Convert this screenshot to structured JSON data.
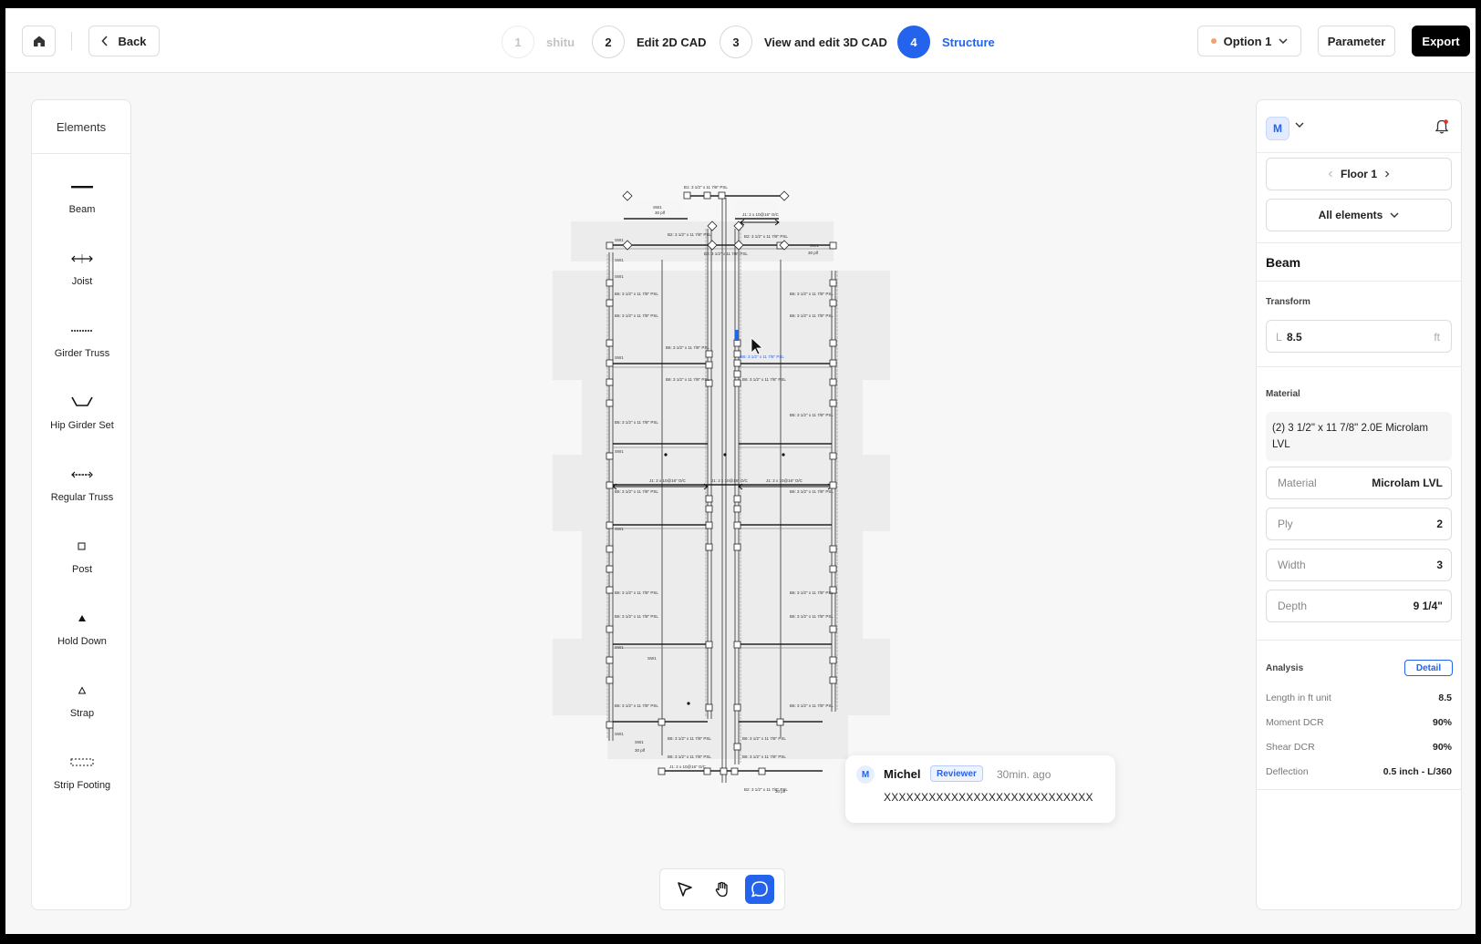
{
  "topbar": {
    "back_label": "Back",
    "steps": [
      {
        "num": "1",
        "label": "shitu"
      },
      {
        "num": "2",
        "label": "Edit 2D CAD"
      },
      {
        "num": "3",
        "label": "View and edit 3D CAD"
      },
      {
        "num": "4",
        "label": "Structure"
      }
    ],
    "option_label": "Option 1",
    "parameter_label": "Parameter",
    "export_label": "Export",
    "accent_color": "#2463eb"
  },
  "elements_panel": {
    "title": "Elements",
    "items": [
      {
        "label": "Beam",
        "icon": "beam-icon"
      },
      {
        "label": "Joist",
        "icon": "joist-icon"
      },
      {
        "label": "Girder Truss",
        "icon": "girder-truss-icon"
      },
      {
        "label": "Hip Girder Set",
        "icon": "hip-girder-set-icon"
      },
      {
        "label": "Regular Truss",
        "icon": "regular-truss-icon"
      },
      {
        "label": "Post",
        "icon": "post-icon"
      },
      {
        "label": "Hold Down",
        "icon": "hold-down-icon"
      },
      {
        "label": "Strap",
        "icon": "strap-icon"
      },
      {
        "label": "Strip Footing",
        "icon": "strip-footing-icon"
      }
    ]
  },
  "comment": {
    "avatar": "M",
    "name": "Michel",
    "role": "Reviewer",
    "time": "30min. ago",
    "text": "XXXXXXXXXXXXXXXXXXXXXXXXXXXX"
  },
  "tools": [
    {
      "name": "select",
      "icon": "cursor-icon",
      "active": false
    },
    {
      "name": "pan",
      "icon": "hand-icon",
      "active": false
    },
    {
      "name": "comment",
      "icon": "comment-icon",
      "active": true
    }
  ],
  "props": {
    "user_avatar": "M",
    "floor_label": "Floor 1",
    "filter_label": "All elements",
    "element_type": "Beam",
    "transform_label": "Transform",
    "length_prefix": "L",
    "length_value": "8.5",
    "length_unit": "ft",
    "material_label": "Material",
    "material_desc": "(2) 3 1/2\" x 11 7/8\" 2.0E Microlam LVL",
    "fields": [
      {
        "key": "Material",
        "value": "Microlam LVL"
      },
      {
        "key": "Ply",
        "value": "2"
      },
      {
        "key": "Width",
        "value": "3"
      },
      {
        "key": "Depth",
        "value": "9 1/4\""
      }
    ],
    "analysis_label": "Analysis",
    "detail_label": "Detail",
    "analysis": [
      {
        "key": "Length in ft unit",
        "value": "8.5"
      },
      {
        "key": "Moment DCR",
        "value": "90%"
      },
      {
        "key": "Shear DCR",
        "value": "90%"
      },
      {
        "key": "Deflection",
        "value": "0.5 inch - L/360"
      }
    ]
  },
  "plan": {
    "beam_labels": [
      "B1: 3 1/2\" x 11 7/8\" PSL",
      "B2: 3 1/2\" x 11 7/8\" PSL",
      "B6: 3 1/2\" x 11 7/8\" PSL",
      "J1: 2 x 10@16\" O/C"
    ],
    "selected_label": "B6: 3 1/2\" x 11 7/8\" PSL",
    "wall_label": "SW1",
    "load_label": "30 plf"
  }
}
